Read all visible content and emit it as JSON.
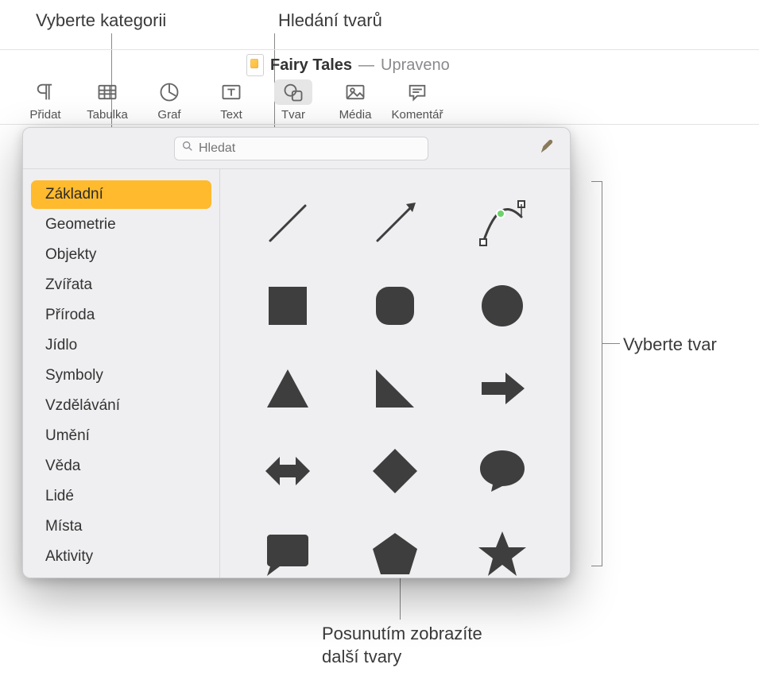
{
  "callouts": {
    "category": "Vyberte kategorii",
    "search": "Hledání tvarů",
    "select_shape": "Vyberte tvar",
    "scroll_more": "Posunutím zobrazíte\ndalší tvary"
  },
  "document": {
    "title": "Fairy Tales",
    "status_sep": "—",
    "status": "Upraveno"
  },
  "toolbar": {
    "items": [
      {
        "label": "Přidat",
        "icon": "paragraph-icon"
      },
      {
        "label": "Tabulka",
        "icon": "table-icon"
      },
      {
        "label": "Graf",
        "icon": "chart-icon"
      },
      {
        "label": "Text",
        "icon": "text-icon"
      },
      {
        "label": "Tvar",
        "icon": "shape-icon",
        "active": true
      },
      {
        "label": "Média",
        "icon": "media-icon"
      },
      {
        "label": "Komentář",
        "icon": "comment-icon"
      }
    ]
  },
  "popover": {
    "search_placeholder": "Hledat",
    "categories": [
      "Základní",
      "Geometrie",
      "Objekty",
      "Zvířata",
      "Příroda",
      "Jídlo",
      "Symboly",
      "Vzdělávání",
      "Umění",
      "Věda",
      "Lidé",
      "Místa",
      "Aktivity"
    ],
    "selected_category_index": 0,
    "shapes": [
      "line",
      "arrow-line",
      "bezier",
      "square",
      "rounded-square",
      "circle",
      "triangle",
      "right-triangle",
      "arrow-right",
      "arrow-leftright",
      "diamond",
      "speech-bubble",
      "quote-bubble",
      "pentagon",
      "star"
    ]
  }
}
